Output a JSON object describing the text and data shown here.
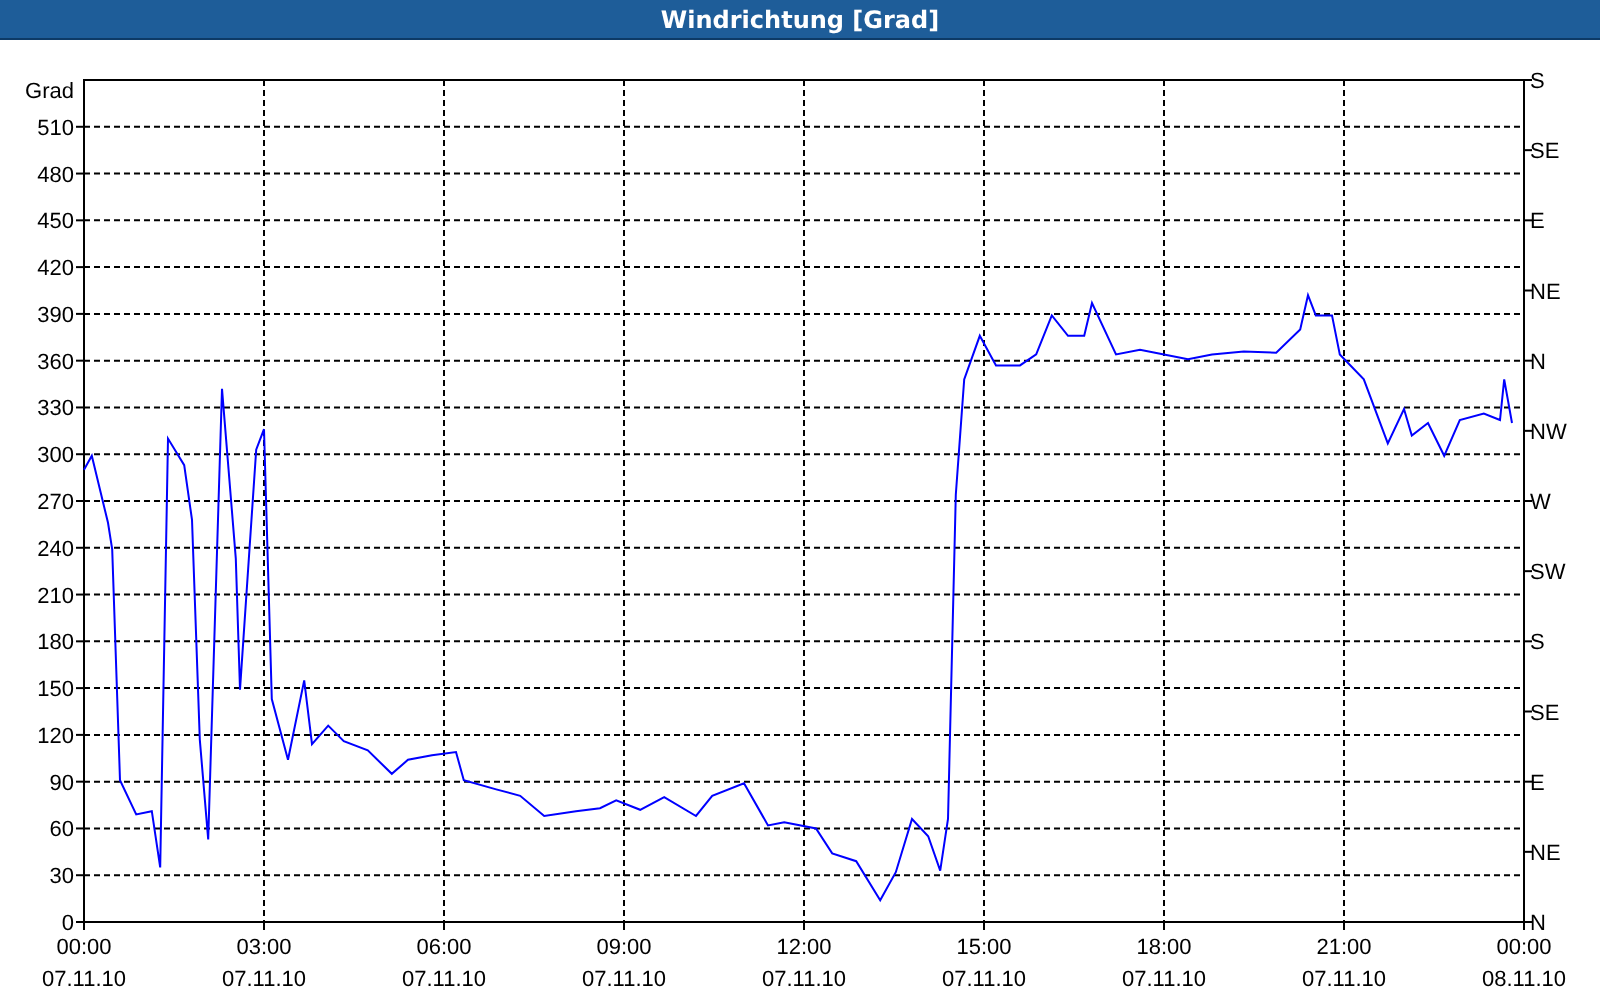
{
  "window": {
    "title": "Windrichtung [Grad]"
  },
  "chart_data": {
    "type": "line",
    "ylabel": "Grad",
    "x": [
      0,
      0.13,
      0.4,
      0.47,
      0.6,
      0.87,
      1.13,
      1.27,
      1.4,
      1.67,
      1.8,
      1.93,
      2.07,
      2.3,
      2.53,
      2.6,
      2.87,
      3,
      3.13,
      3.4,
      3.67,
      3.8,
      4.07,
      4.33,
      4.73,
      5.13,
      5.4,
      5.8,
      6.2,
      6.33,
      6.87,
      7.27,
      7.67,
      8.2,
      8.6,
      8.87,
      9.27,
      9.67,
      10.2,
      10.47,
      11,
      11.4,
      11.67,
      12.2,
      12.47,
      12.87,
      13.27,
      13.53,
      13.8,
      14.07,
      14.27,
      14.4,
      14.53,
      14.67,
      14.93,
      15.2,
      15.6,
      15.87,
      16.13,
      16.4,
      16.67,
      16.8,
      17.2,
      17.6,
      18,
      18.4,
      18.8,
      19.33,
      19.87,
      20.27,
      20.4,
      20.53,
      20.8,
      20.93,
      21.33,
      21.73,
      22,
      22.13,
      22.4,
      22.67,
      22.93,
      23.33,
      23.6,
      23.67,
      23.8
    ],
    "series": [
      {
        "color": "#0000ff",
        "values": [
          290,
          299,
          256,
          239,
          91,
          69,
          71,
          35,
          310,
          293,
          258,
          117,
          53,
          342,
          233,
          149,
          303,
          316,
          143,
          104,
          155,
          114,
          126,
          116,
          110,
          95,
          104,
          107,
          109,
          91,
          85,
          81,
          68,
          71,
          73,
          78,
          72,
          80,
          68,
          81,
          89,
          62,
          64,
          60,
          44,
          39,
          14,
          32,
          66,
          55,
          33,
          66,
          274,
          348,
          376,
          357,
          357,
          364,
          389,
          376,
          376,
          397,
          364,
          367,
          364,
          361,
          364,
          366,
          365,
          380,
          402,
          389,
          389,
          364,
          348,
          307,
          329,
          312,
          320,
          299,
          322,
          326,
          322,
          348,
          320
        ]
      }
    ],
    "xlim": [
      0,
      24
    ],
    "ylim": [
      0,
      540
    ],
    "grid": true,
    "xticks": [
      {
        "value": 0,
        "label": "00:00"
      },
      {
        "value": 3,
        "label": "03:00"
      },
      {
        "value": 6,
        "label": "06:00"
      },
      {
        "value": 9,
        "label": "09:00"
      },
      {
        "value": 12,
        "label": "12:00"
      },
      {
        "value": 15,
        "label": "15:00"
      },
      {
        "value": 18,
        "label": "18:00"
      },
      {
        "value": 21,
        "label": "21:00"
      },
      {
        "value": 24,
        "label": "00:00"
      }
    ],
    "yticks": [
      0,
      30,
      60,
      90,
      120,
      150,
      180,
      210,
      240,
      270,
      300,
      330,
      360,
      390,
      420,
      450,
      480,
      510
    ]
  },
  "date_labels": [
    "07.11.10",
    "07.11.10",
    "07.11.10",
    "07.11.10",
    "07.11.10",
    "07.11.10",
    "07.11.10",
    "07.11.10",
    "08.11.10"
  ],
  "compass_labels": [
    "S",
    "SE",
    "E",
    "NE",
    "N",
    "NW",
    "W",
    "SW",
    "S",
    "SE",
    "E",
    "NE",
    "N"
  ]
}
